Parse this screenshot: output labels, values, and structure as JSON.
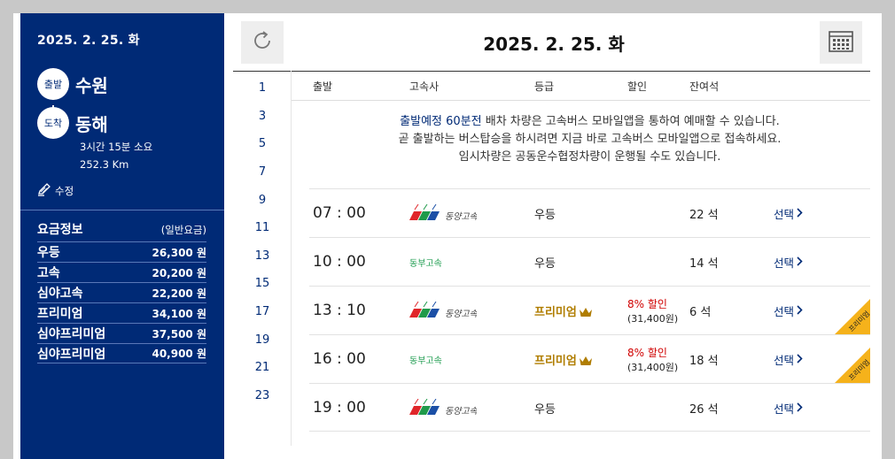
{
  "trip": {
    "date": "2025. 2. 25. 화",
    "departure_label": "출발",
    "departure": "수원",
    "arrival_label": "도착",
    "arrival": "동해",
    "duration": "3시간 15분 소요",
    "distance": "252.3 Km",
    "edit_label": "수정"
  },
  "fare_info": {
    "title": "요금정보",
    "subtitle": "(일반요금)",
    "rows": [
      {
        "grade": "우등",
        "price": "26,300 원"
      },
      {
        "grade": "고속",
        "price": "20,200 원"
      },
      {
        "grade": "심야고속",
        "price": "22,200 원"
      },
      {
        "grade": "프리미엄",
        "price": "34,100 원"
      },
      {
        "grade": "심야프리미엄",
        "price": "37,500 원"
      },
      {
        "grade": "심야프리미엄",
        "price": "40,900 원"
      }
    ]
  },
  "header": {
    "date": "2025. 2. 25. 화",
    "refresh_icon": "refresh-icon",
    "calendar_icon": "calendar-icon"
  },
  "hours": [
    "1",
    "3",
    "5",
    "7",
    "9",
    "11",
    "13",
    "15",
    "17",
    "19",
    "21",
    "23"
  ],
  "columns": {
    "departure": "출발",
    "company": "고속사",
    "grade": "등급",
    "discount": "할인",
    "seats": "잔여석"
  },
  "notice": {
    "highlight": "출발예정 60분전",
    "line1_rest": " 배차 차량은 고속버스 모바일앱을 통하여 예매할 수 있습니다.",
    "line2": "곧 출발하는 버스탑승을 하시려면 지금 바로 고속버스 모바일앱으로 접속하세요.",
    "line3": "임시차량은 공동운수협정차량이 운행될 수도 있습니다."
  },
  "schedules": [
    {
      "time": "07 : 00",
      "company": "동양고속",
      "company_logo": true,
      "grade": "우등",
      "premium": false,
      "discount": "",
      "discount_price": "",
      "seats": "22 석",
      "select": "선택",
      "ribbon": ""
    },
    {
      "time": "10 : 00",
      "company": "동부고속",
      "company_logo": false,
      "grade": "우등",
      "premium": false,
      "discount": "",
      "discount_price": "",
      "seats": "14 석",
      "select": "선택",
      "ribbon": ""
    },
    {
      "time": "13 : 10",
      "company": "동양고속",
      "company_logo": true,
      "grade": "프리미엄",
      "premium": true,
      "discount": "8% 할인",
      "discount_price": "(31,400원)",
      "seats": "6 석",
      "select": "선택",
      "ribbon": "프리미엄"
    },
    {
      "time": "16 : 00",
      "company": "동부고속",
      "company_logo": false,
      "grade": "프리미엄",
      "premium": true,
      "discount": "8% 할인",
      "discount_price": "(31,400원)",
      "seats": "18 석",
      "select": "선택",
      "ribbon": "프리미엄"
    },
    {
      "time": "19 : 00",
      "company": "동양고속",
      "company_logo": true,
      "grade": "우등",
      "premium": false,
      "discount": "",
      "discount_price": "",
      "seats": "26 석",
      "select": "선택",
      "ribbon": ""
    }
  ],
  "colors": {
    "navy": "#002a76",
    "premium_gold": "#b07d00",
    "discount_red": "#d00000",
    "ribbon": "#f5b21b",
    "dongbu_green": "#1e9c4f"
  }
}
